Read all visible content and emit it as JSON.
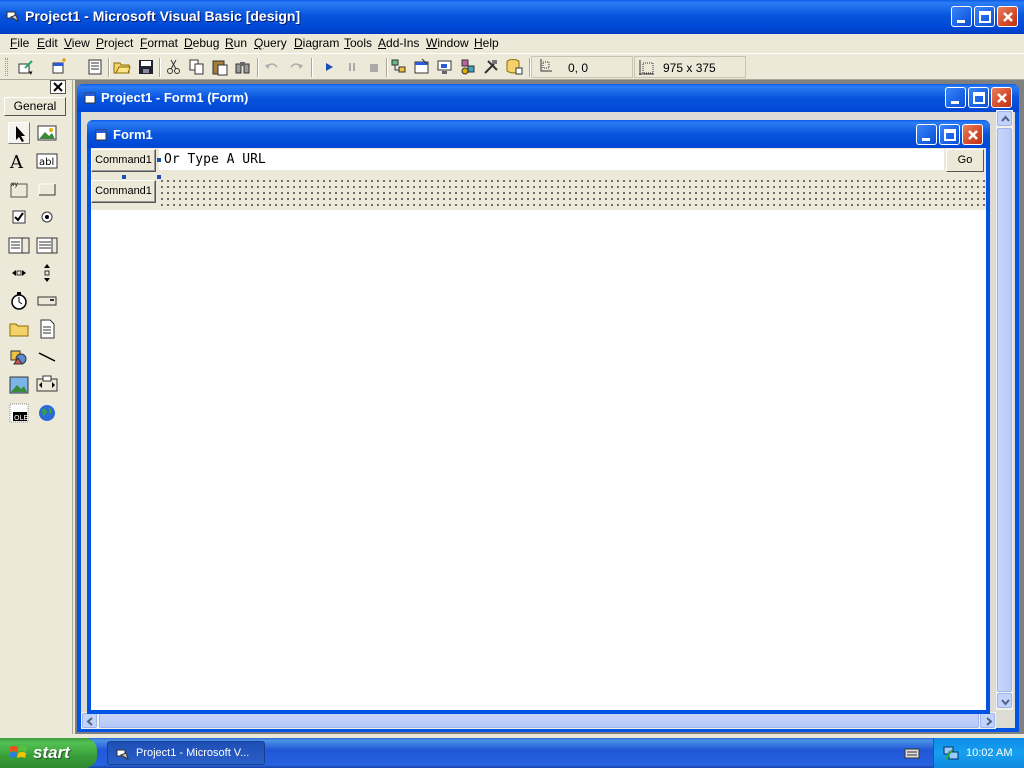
{
  "window": {
    "title": "Project1 - Microsoft Visual Basic [design]"
  },
  "menu": [
    "File",
    "Edit",
    "View",
    "Project",
    "Format",
    "Debug",
    "Run",
    "Query",
    "Diagram",
    "Tools",
    "Add-Ins",
    "Window",
    "Help"
  ],
  "toolbar": {
    "position_readout": "0, 0",
    "size_readout": "975 x 375",
    "icons": [
      "add-project-icon",
      "add-form-icon",
      "menu-editor-icon",
      "open-project-icon",
      "save-project-icon",
      "cut-icon",
      "copy-icon",
      "paste-icon",
      "find-icon",
      "undo-icon",
      "redo-icon",
      "start-icon",
      "break-icon",
      "end-icon",
      "project-explorer-icon",
      "properties-window-icon",
      "form-layout-icon",
      "object-browser-icon",
      "toolbox-icon",
      "data-view-icon"
    ]
  },
  "toolbox": {
    "tab_label": "General",
    "tools": [
      "pointer",
      "picturebox",
      "label",
      "textbox",
      "frame",
      "commandbutton",
      "checkbox",
      "optionbutton",
      "combobox",
      "listbox",
      "hscrollbar",
      "vscrollbar",
      "timer",
      "drivelistbox",
      "dirlistbox",
      "filelistbox",
      "shape",
      "line",
      "image",
      "data",
      "ole",
      "webbrowser"
    ]
  },
  "designer": {
    "title": "Project1 - Form1 (Form)"
  },
  "form": {
    "title": "Form1",
    "command1_label": "Command1",
    "command2_label": "Command1",
    "url_text": "Or Type A URL",
    "go_label": "Go"
  },
  "taskbar": {
    "start_label": "start",
    "task_label": "Project1 - Microsoft V...",
    "clock": "10:02 AM"
  },
  "colors": {
    "title_blue": "#0054e3",
    "start_green": "#3c9b3c",
    "face": "#ece9d8"
  }
}
